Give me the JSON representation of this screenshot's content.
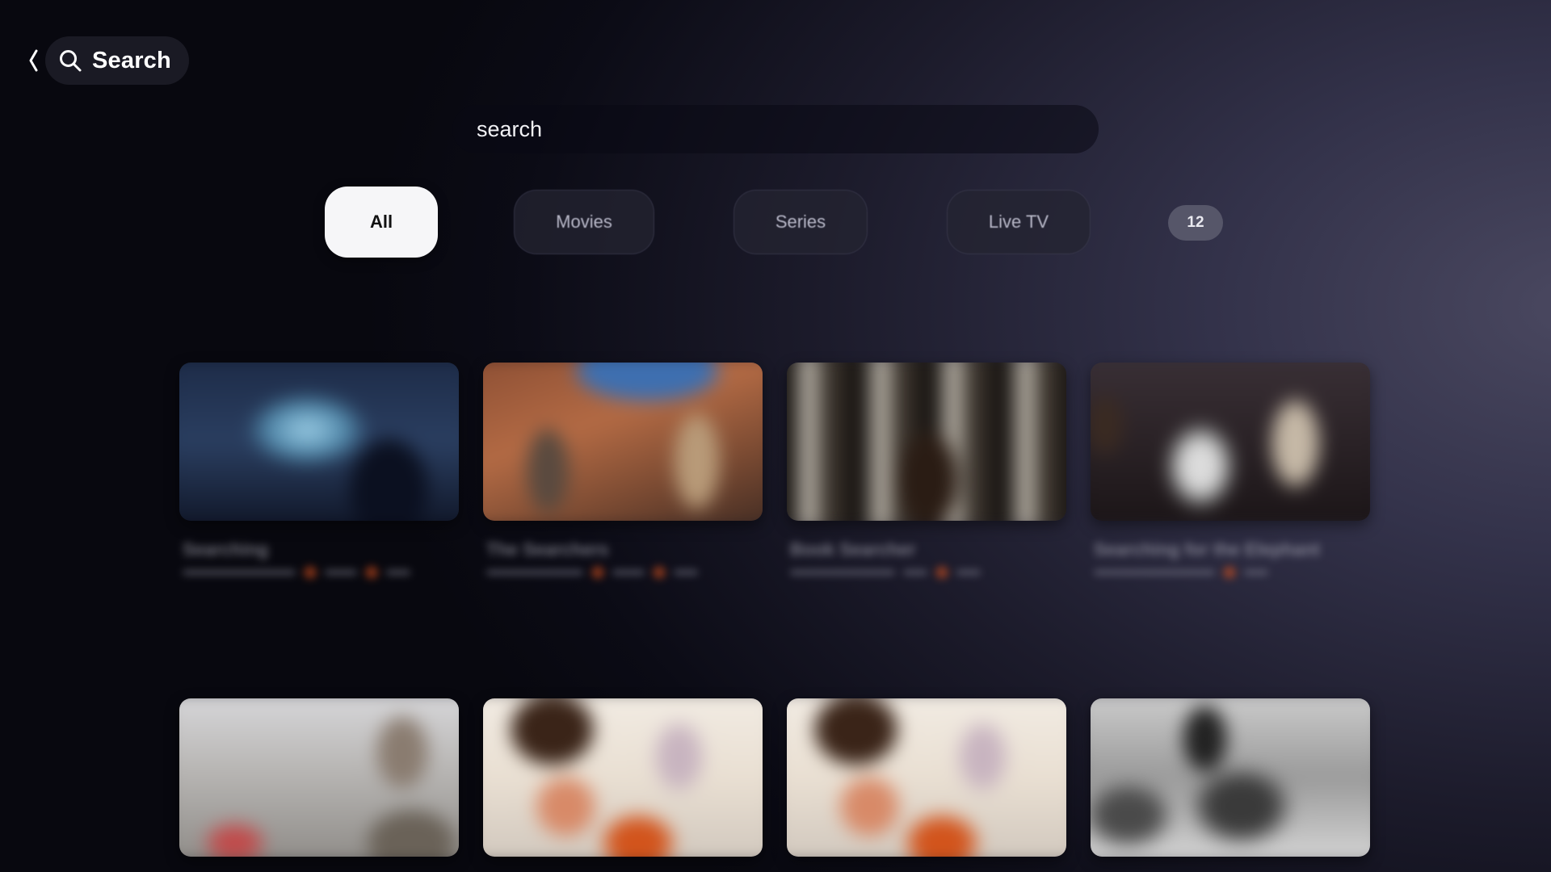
{
  "header": {
    "title": "Search",
    "icons": {
      "back": "chevron-left-icon",
      "search": "magnifier-icon"
    }
  },
  "search": {
    "value": "search"
  },
  "filters": {
    "tabs": [
      {
        "label": "All",
        "active": true
      },
      {
        "label": "Movies",
        "active": false
      },
      {
        "label": "Series",
        "active": false
      },
      {
        "label": "Live TV",
        "active": false
      }
    ],
    "result_count": "12"
  },
  "results": [
    {
      "row": 1,
      "title": "Searching",
      "thumbnail": "dark-room-monitor"
    },
    {
      "row": 1,
      "title": "The Searchers",
      "thumbnail": "western-cowboys"
    },
    {
      "row": 1,
      "title": "Book Searcher",
      "thumbnail": "library-shelves"
    },
    {
      "row": 1,
      "title": "Searching for the Elephant",
      "thumbnail": "man-with-hat"
    },
    {
      "row": 2,
      "title": "",
      "thumbnail": "man-in-jacket"
    },
    {
      "row": 2,
      "title": "",
      "thumbnail": "animated-characters"
    },
    {
      "row": 2,
      "title": "",
      "thumbnail": "animated-characters"
    },
    {
      "row": 2,
      "title": "",
      "thumbnail": "black-and-white-scene"
    }
  ],
  "colors": {
    "active_tab_bg": "#f6f6f8",
    "badge_bg": "#58586c",
    "rating_dot": "#e0551e"
  }
}
